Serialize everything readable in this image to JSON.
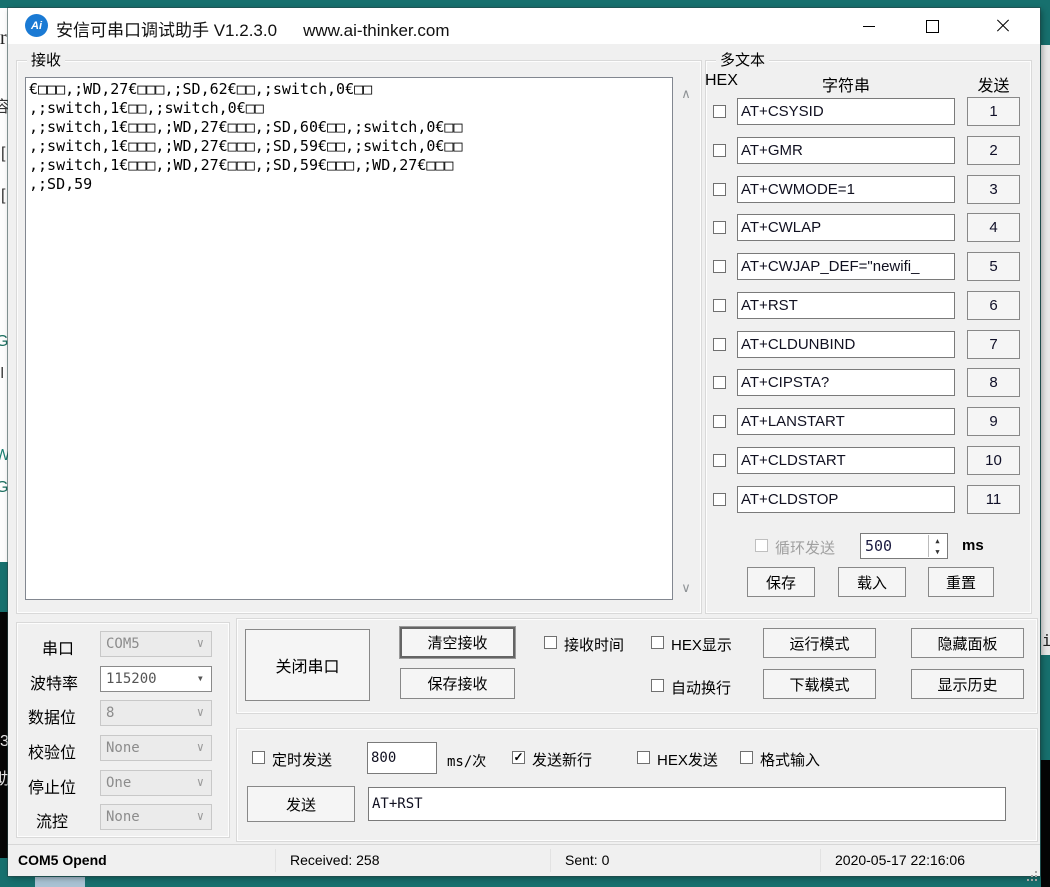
{
  "titlebar": {
    "app_title": "安信可串口调试助手 V1.2.3.0",
    "website": "www.ai-thinker.com",
    "logo_text": "Ai"
  },
  "receive": {
    "panel_title": "接收",
    "text": "€□□□,;WD,27€□□□,;SD,62€□□,;switch,0€□□\n,;switch,1€□□,;switch,0€□□\n,;switch,1€□□□,;WD,27€□□□,;SD,60€□□,;switch,0€□□\n,;switch,1€□□□,;WD,27€□□□,;SD,59€□□,;switch,0€□□\n,;switch,1€□□□,;WD,27€□□□,;SD,59€□□□,;WD,27€□□□\n,;SD,59"
  },
  "multitext": {
    "panel_title": "多文本",
    "col_hex": "HEX",
    "col_string": "字符串",
    "col_send": "发送",
    "rows": [
      {
        "cmd": "AT+CSYSID",
        "num": "1"
      },
      {
        "cmd": "AT+GMR",
        "num": "2"
      },
      {
        "cmd": "AT+CWMODE=1",
        "num": "3"
      },
      {
        "cmd": "AT+CWLAP",
        "num": "4"
      },
      {
        "cmd": "AT+CWJAP_DEF=\"newifi_",
        "num": "5"
      },
      {
        "cmd": "AT+RST",
        "num": "6"
      },
      {
        "cmd": "AT+CLDUNBIND",
        "num": "7"
      },
      {
        "cmd": "AT+CIPSTA?",
        "num": "8"
      },
      {
        "cmd": "AT+LANSTART",
        "num": "9"
      },
      {
        "cmd": "AT+CLDSTART",
        "num": "10"
      },
      {
        "cmd": "AT+CLDSTOP",
        "num": "11"
      }
    ],
    "loop_label": "循环发送",
    "loop_interval": "500",
    "loop_unit": "ms",
    "save_label": "保存",
    "load_label": "载入",
    "reset_label": "重置"
  },
  "serial": {
    "rows": [
      {
        "label": "串口",
        "value": "COM5"
      },
      {
        "label": "波特率",
        "value": "115200"
      },
      {
        "label": "数据位",
        "value": "8"
      },
      {
        "label": "校验位",
        "value": "None"
      },
      {
        "label": "停止位",
        "value": "One"
      },
      {
        "label": "流控",
        "value": "None"
      }
    ]
  },
  "controls": {
    "close_serial": "关闭串口",
    "clear_receive": "清空接收",
    "save_receive": "保存接收",
    "receive_time": "接收时间",
    "hex_display": "HEX显示",
    "auto_newline": "自动换行",
    "run_mode": "运行模式",
    "download_mode": "下载模式",
    "hide_panel": "隐藏面板",
    "show_history": "显示历史"
  },
  "send": {
    "timed_send": "定时发送",
    "interval": "800",
    "interval_unit": "ms/次",
    "send_newline": "发送新行",
    "hex_send": "HEX发送",
    "format_input": "格式输入",
    "send_label": "发送",
    "input_value": "AT+RST"
  },
  "statusbar": {
    "port_status": "COM5 Opend",
    "received": "Received: 258",
    "sent": "Sent: 0",
    "datetime": "2020-05-17 22:16:06"
  },
  "backdrop": {
    "left_glyphs": [
      "r",
      "容",
      "[",
      "[",
      "G",
      "I",
      "W",
      "G",
      "3",
      "助"
    ],
    "right_glyph": "i"
  }
}
